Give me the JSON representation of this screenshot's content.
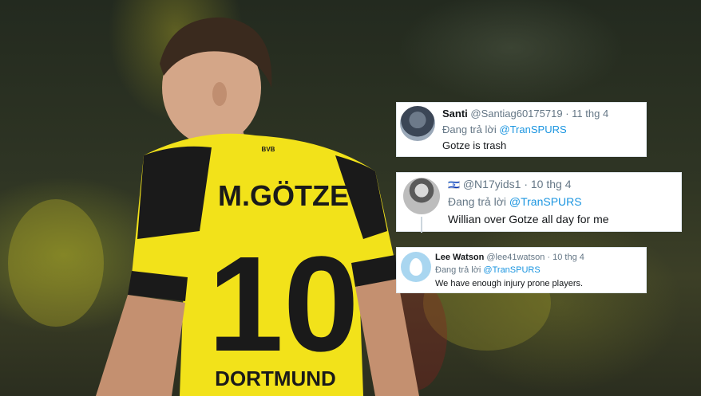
{
  "tweets": [
    {
      "name": "Santi",
      "handle": "@Santiag60175719",
      "date": "11 thg 4",
      "reply_prefix": "Đang trả lời",
      "reply_to": "@TranSPURS",
      "text": "Gotze is trash"
    },
    {
      "name": "",
      "flag": "🇮🇱",
      "handle": "@N17yids1",
      "date": "10 thg 4",
      "reply_prefix": "Đang trả lời",
      "reply_to": "@TranSPURS",
      "text": "Willian over Gotze all day for me"
    },
    {
      "name": "Lee Watson",
      "handle": "@lee41watson",
      "date": "10 thg 4",
      "reply_prefix": "Đang trả lời",
      "reply_to": "@TranSPURS",
      "text": "We have enough injury prone players."
    }
  ],
  "jersey": {
    "name": "M.GÖTZE",
    "number": "10",
    "club": "DORTMUND",
    "brand": "BVB"
  },
  "colors": {
    "jersey_yellow": "#f2e21a",
    "jersey_black": "#1a1a1a",
    "link_blue": "#1b95e0"
  }
}
